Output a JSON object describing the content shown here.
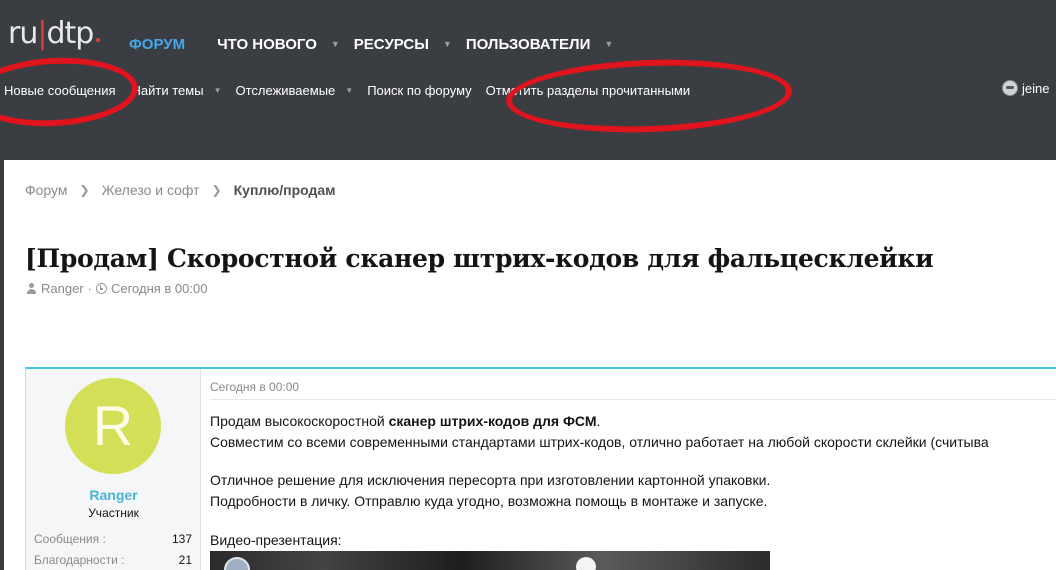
{
  "logo": {
    "text_a": "ru",
    "text_bar": "|",
    "text_b": "dtp"
  },
  "topnav": {
    "forum": "ФОРУМ",
    "news": "ЧТО НОВОГО",
    "resources": "РЕСУРСЫ",
    "members": "ПОЛЬЗОВАТЕЛИ",
    "active": "ФОРУМ"
  },
  "subnav": {
    "new_posts": "Новые сообщения",
    "find_threads": "Найти темы",
    "watched": "Отслеживаемые",
    "search_forum": "Поиск по форуму",
    "mark_read": "Отметить разделы прочитанными"
  },
  "user": {
    "name": "jeine"
  },
  "breadcrumbs": [
    "Форум",
    "Железо и софт",
    "Куплю/продам"
  ],
  "thread": {
    "title": "[Продам] Скоростной сканер штрих-кодов для фальцесклейки",
    "author": "Ranger",
    "date": "Сегодня в 00:00"
  },
  "post": {
    "avatar_letter": "R",
    "username": "Ranger",
    "user_title": "Участник",
    "stats": [
      {
        "label": "Сообщения :",
        "value": "137"
      },
      {
        "label": "Благодарности :",
        "value": "21"
      }
    ],
    "date": "Сегодня в 00:00",
    "line1_pre": "Продам высокоскоростной ",
    "line1_bold": "сканер штрих-кодов для ФСМ",
    "line1_post": ".",
    "line2": "Совместим со всеми современными стандартами штрих-кодов, отлично работает на любой скорости склейки (считыва",
    "line3": "Отличное решение для исключения пересорта при изготовлении картонной упаковки.",
    "line4": "Подробности в личку. Отправлю куда угодно, возможна помощь в монтаже и запуске.",
    "line5": "Видео-презентация:"
  },
  "colors": {
    "header_bg": "#3b3e43",
    "accent_active": "#47a7eb",
    "annotation": "#e0141c",
    "username": "#47b5d6",
    "avatar_bg": "#d4df58",
    "message_border": "#47c6dc"
  }
}
